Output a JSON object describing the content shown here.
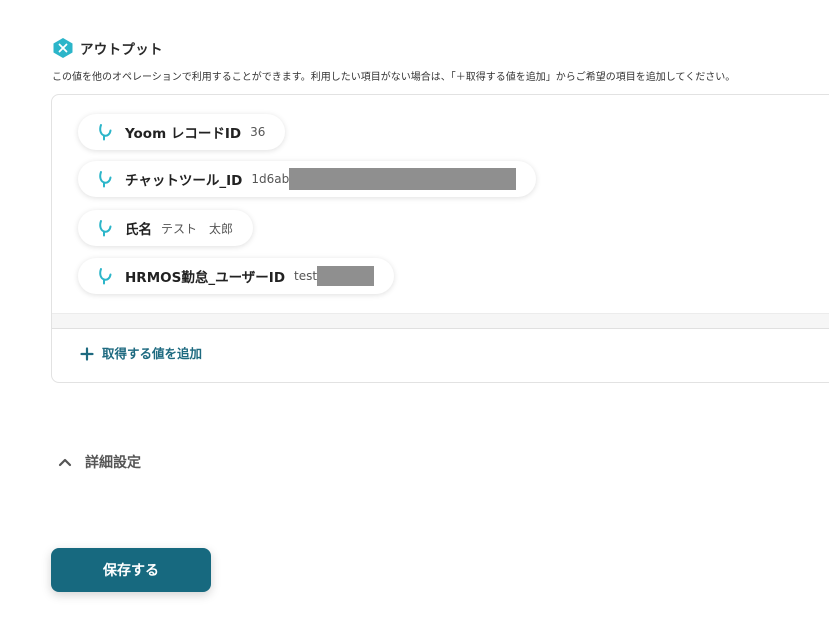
{
  "output_section": {
    "icon": "yoom-output-icon",
    "title": "アウトプット",
    "description": "この値を他のオペレーションで利用することができます。利用したい項目がない場合は、「＋取得する値を追加」からご希望の項目を追加してください。"
  },
  "outputs": [
    {
      "label": "Yoom レコードID",
      "value": "36",
      "icon": "variable-icon"
    },
    {
      "label": "チャットツール_ID",
      "value": "1d6ab",
      "icon": "variable-icon",
      "redacted": true
    },
    {
      "label": "氏名",
      "value": "テスト　太郎",
      "icon": "variable-icon"
    },
    {
      "label": "HRMOS勤怠_ユーザーID",
      "value": "test",
      "icon": "variable-icon",
      "redacted": true
    }
  ],
  "add_value_label": "取得する値を追加",
  "details_label": "詳細設定",
  "save_label": "保存する",
  "colors": {
    "accent": "#17697f",
    "icon_teal": "#2bb5c9"
  }
}
